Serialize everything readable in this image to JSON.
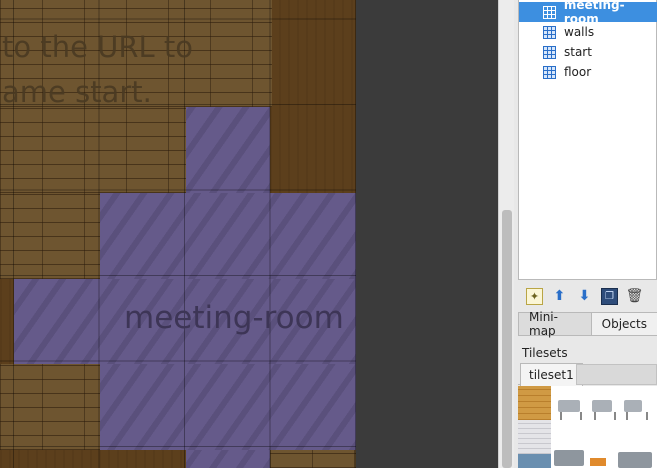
{
  "map": {
    "hint_line1": "to the URL to",
    "hint_line2": "ame start.",
    "room_label": "meeting-room"
  },
  "layers": [
    {
      "label": "meeting-room",
      "icon": "tile-layer-icon",
      "selected": true
    },
    {
      "label": "walls",
      "icon": "tile-layer-icon",
      "selected": false
    },
    {
      "label": "start",
      "icon": "tile-layer-icon",
      "selected": false
    },
    {
      "label": "floor",
      "icon": "tile-layer-icon",
      "selected": false
    }
  ],
  "layer_toolbar": {
    "new_icon": "new-layer-icon",
    "up_icon": "move-layer-up-icon",
    "down_icon": "move-layer-down-icon",
    "dup_icon": "duplicate-layer-icon",
    "del_icon": "delete-layer-icon"
  },
  "tabs": {
    "minimap": "Mini-map",
    "objects": "Objects"
  },
  "tilesets": {
    "title": "Tilesets",
    "tab": "tileset1"
  },
  "colors": {
    "selection": "#3d8fe0",
    "room_fill": "#655a8a",
    "wood": "#6e5530"
  }
}
